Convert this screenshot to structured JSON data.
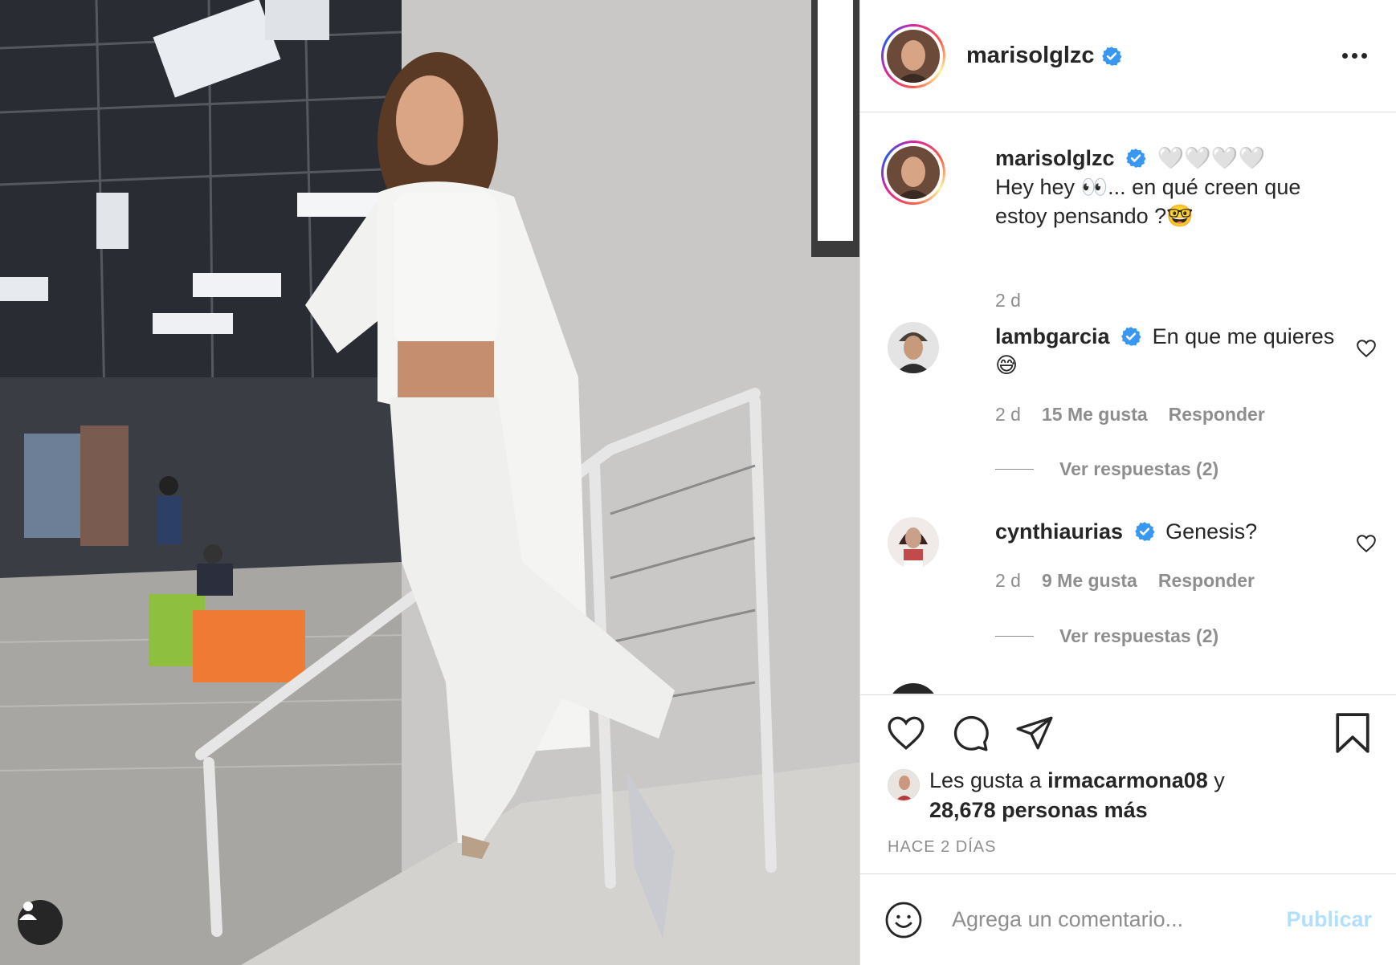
{
  "post": {
    "author": "marisolglzc",
    "verified": true
  },
  "caption": {
    "username": "marisolglzc",
    "text_line1": "🤍🤍🤍🤍",
    "text_line2": "Hey hey 👀... en qué creen que estoy pensando ?🤓",
    "time": "2 d"
  },
  "comments": [
    {
      "username": "lambgarcia",
      "text": "En que me quieres 😅",
      "time": "2 d",
      "likes": "15 Me gusta",
      "reply_label": "Responder",
      "view_replies": "Ver respuestas (2)"
    },
    {
      "username": "cynthiaurias",
      "text": "Genesis?",
      "time": "2 d",
      "likes": "9 Me gusta",
      "reply_label": "Responder",
      "view_replies": "Ver respuestas (2)"
    }
  ],
  "likes": {
    "prefix": "Les gusta a",
    "user": "irmacarmona08",
    "connector": "y",
    "others": "28,678 personas más"
  },
  "posted_ago": "HACE 2 DÍAS",
  "add_comment": {
    "placeholder": "Agrega un comentario...",
    "publish_label": "Publicar"
  },
  "icons": [
    "user-tag-icon",
    "more-options-icon",
    "verified-icon",
    "heart-icon",
    "comment-icon",
    "share-icon",
    "bookmark-icon",
    "emoji-icon"
  ],
  "colors": {
    "verified": "#3897f0",
    "publish": "#b2dffc",
    "muted": "#8e8e8e",
    "text": "#262626"
  }
}
